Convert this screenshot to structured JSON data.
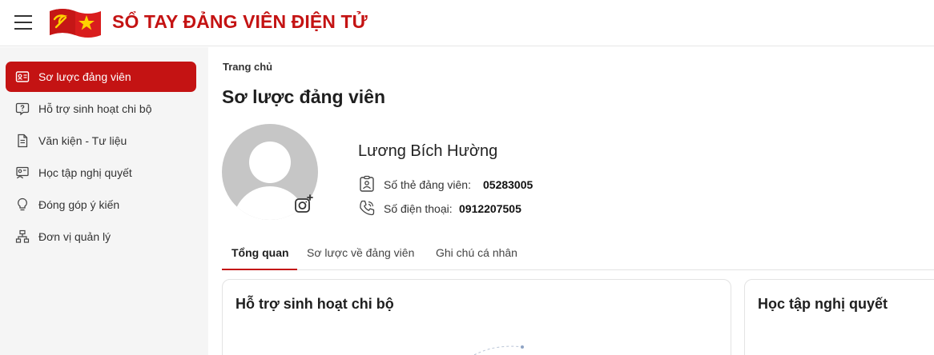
{
  "app": {
    "title": "SỔ TAY ĐẢNG VIÊN ĐIỆN TỬ"
  },
  "sidebar": {
    "items": [
      {
        "label": "Sơ lược đảng viên",
        "icon": "id-card-icon"
      },
      {
        "label": "Hỗ trợ sinh hoạt chi bộ",
        "icon": "help-chat-icon"
      },
      {
        "label": "Văn kiện - Tư liệu",
        "icon": "document-icon"
      },
      {
        "label": "Học tập nghị quyết",
        "icon": "study-icon"
      },
      {
        "label": "Đóng góp ý kiến",
        "icon": "lightbulb-icon"
      },
      {
        "label": "Đơn vị quản lý",
        "icon": "org-chart-icon"
      }
    ]
  },
  "main": {
    "breadcrumb": "Trang chủ",
    "title": "Sơ lược đảng viên",
    "member": {
      "name": "Lương Bích Hường",
      "card_label": "Số thẻ đảng viên:",
      "card_number": "05283005",
      "phone_label": "Số điện thoại:",
      "phone": "0912207505"
    },
    "tabs": [
      {
        "label": "Tổng quan"
      },
      {
        "label": "Sơ lược về đảng viên"
      },
      {
        "label": "Ghi chú cá nhân"
      }
    ],
    "cards": [
      {
        "title": "Hỗ trợ sinh hoạt chi bộ"
      },
      {
        "title": "Học tập nghị quyết"
      }
    ]
  },
  "colors": {
    "accent": "#c41313",
    "sidebar_bg": "#f5f5f5"
  }
}
